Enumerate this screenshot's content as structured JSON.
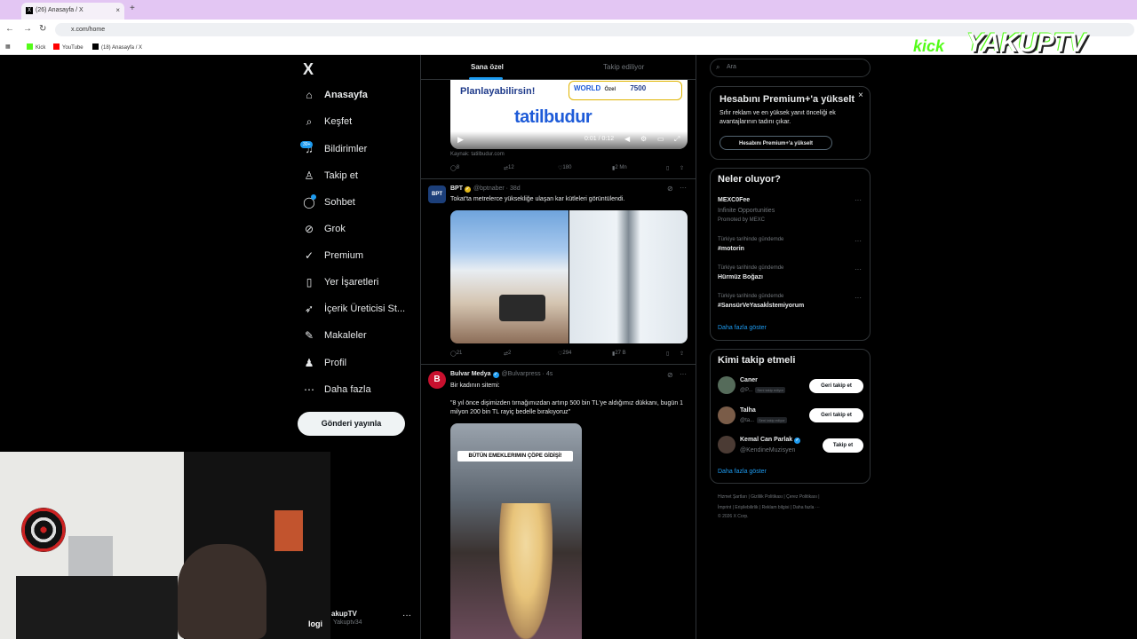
{
  "browser": {
    "tab_title": "(26) Anasayfa / X",
    "tab_close": "×",
    "new_tab": "+",
    "url": "x.com/home",
    "bookmarks": [
      "Kick",
      "YouTube",
      "(18) Anasayfa / X"
    ]
  },
  "nav": {
    "logo": "X",
    "items": [
      {
        "label": "Anasayfa",
        "icon": "home-icon"
      },
      {
        "label": "Keşfet",
        "icon": "search-icon"
      },
      {
        "label": "Bildirimler",
        "icon": "bell-icon"
      },
      {
        "label": "Takip et",
        "icon": "person-add-icon"
      },
      {
        "label": "Sohbet",
        "icon": "chat-icon"
      },
      {
        "label": "Grok",
        "icon": "grok-icon"
      },
      {
        "label": "Premium",
        "icon": "premium-icon"
      },
      {
        "label": "Yer İşaretleri",
        "icon": "bookmark-icon"
      },
      {
        "label": "İçerik Üreticisi St...",
        "icon": "rocket-icon"
      },
      {
        "label": "Makaleler",
        "icon": "article-icon"
      },
      {
        "label": "Profil",
        "icon": "profile-icon"
      },
      {
        "label": "Daha fazla",
        "icon": "more-circle-icon"
      }
    ],
    "notif_badge": "30+",
    "post_button": "Gönderi yayınla",
    "account_name": "akupTV",
    "account_handle": "Yakuptv34",
    "account_more": "···"
  },
  "feed": {
    "tab_for_you": "Sana özel",
    "tab_following": "Takip ediliyor",
    "ad": {
      "headline": "Planlayabilirsin!",
      "world_label": "WORLD",
      "world_special": "Özel",
      "world_price": "7500",
      "brand": "tatilbudur",
      "time": "0:01 / 0:12",
      "source": "Kaynak: tatilbudur.com",
      "stats": {
        "replies": "8",
        "reposts": "12",
        "likes": "180",
        "views": "2 Mn"
      }
    },
    "tweets": [
      {
        "name": "BPT",
        "handle": "@bptnaber · 38d",
        "avatar_text": "BPT",
        "text": "Tokat'ta metrelerce yüksekliğe ulaşan kar kütleleri görüntülendi.",
        "stats": {
          "replies": "21",
          "reposts": "2",
          "likes": "294",
          "views": "27 B"
        }
      },
      {
        "name": "Bulvar Medya",
        "handle": "@Bulvarpress · 4s",
        "avatar_text": "B",
        "text1": "Bir kadının sitemi:",
        "text2": "\"8 yıl önce dişimizden tırnağımızdan artırıp 500 bin TL'ye aldığımız dükkanı, bugün 1 milyon 200 bin TL rayiç bedelle bırakıyoruz\"",
        "video_caption": "BÜTÜN EMEKLERIMIN ÇÖPE GİDİŞİ!"
      }
    ],
    "more": "···"
  },
  "sidebar": {
    "search_placeholder": "Ara",
    "premium": {
      "title": "Hesabını Premium+'a yükselt",
      "desc": "Sıfır reklam ve en yüksek yanıt önceliği ek avantajlarının tadını çıkar.",
      "button": "Hesabını Premium+'a yükselt",
      "close": "×"
    },
    "trends": {
      "title": "Neler oluyor?",
      "items": [
        {
          "meta": "",
          "name": "MEXC0Fee",
          "sub": "Infinite Opportunities",
          "promo": "Promoted by MEXC"
        },
        {
          "meta": "Türkiye tarihinde gündemde",
          "name": "#motorin"
        },
        {
          "meta": "Türkiye tarihinde gündemde",
          "name": "Hürmüz Boğazı"
        },
        {
          "meta": "Türkiye tarihinde gündemde",
          "name": "#SansürVeYasakİstemiyorum"
        }
      ],
      "show_more": "Daha fazla göster"
    },
    "who_to_follow": {
      "title": "Kimi takip etmeli",
      "items": [
        {
          "name": "Caner",
          "handle": "@P...",
          "follows_you": "Seni takip ediyor",
          "button": "Geri takip et"
        },
        {
          "name": "Talha",
          "handle": "@ta...",
          "follows_you": "Seni takip ediyor",
          "button": "Geri takip et"
        },
        {
          "name": "Kemal Can Parlak",
          "handle": "@KendineMuzisyen",
          "follows_you": "",
          "button": "Takip et"
        }
      ],
      "show_more": "Daha fazla göster"
    },
    "footer": [
      "Hizmet Şartları",
      "|",
      "Gizlilik Politikası",
      "|",
      "Çerez Politikası",
      "|",
      "İmprint",
      "|",
      "Erişilebilirlik",
      "|",
      "Reklam bilgisi",
      "|",
      "Daha fazla ···",
      "© 2026 X Corp."
    ]
  },
  "overlay": {
    "kick": "kick",
    "brand": "YAKUPTV",
    "logi": "logi"
  }
}
